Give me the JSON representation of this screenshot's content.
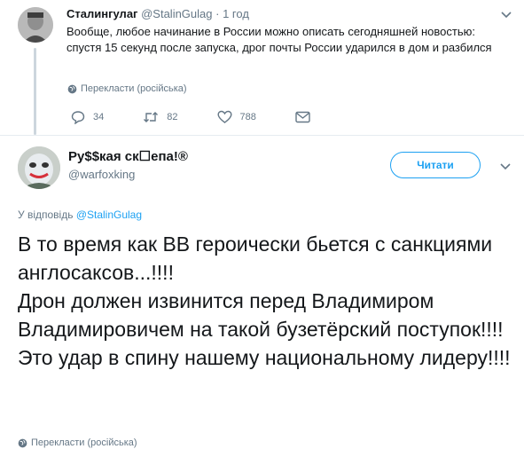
{
  "tweet1": {
    "name": "Сталингулаг",
    "handle": "@StalinGulag",
    "separator": "·",
    "time": "1 год",
    "text": "Вообще, любое начинание в России можно описать сегодняшней новостью: спустя 15 секунд после запуска, дрог почты России ударился в дом и разбился",
    "translate": "Перекласти (російська)",
    "replies": "34",
    "retweets": "82",
    "likes": "788"
  },
  "tweet2": {
    "name": "Ру$$кая ск☐епа!®",
    "handle": "@warfoxking",
    "follow_label": "Читати",
    "reply_prefix": "У відповідь",
    "reply_handle": "@StalinGulag",
    "text_lines": [
      "В то время как ВВ героически бьется с санкциями англосаксов...!!!!",
      "Дрон должен извинится перед Владимиром Владимировичем на такой бузетёрский поступок!!!!",
      "Это удар в спину нашему национальному лидеру!!!!"
    ],
    "translate": "Перекласти (російська)"
  },
  "colors": {
    "accent": "#1da1f2",
    "muted": "#657786",
    "text": "#14171a"
  },
  "icons": [
    "chevron-down-icon",
    "globe-icon",
    "reply-icon",
    "retweet-icon",
    "heart-icon",
    "mail-icon"
  ]
}
